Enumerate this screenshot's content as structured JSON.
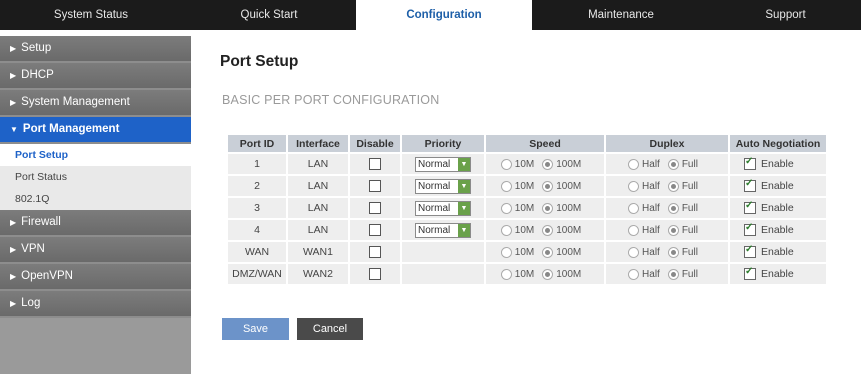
{
  "topnav": {
    "tabs": [
      {
        "label": "System Status"
      },
      {
        "label": "Quick Start"
      },
      {
        "label": "Configuration"
      },
      {
        "label": "Maintenance"
      },
      {
        "label": "Support"
      }
    ],
    "active": "Configuration"
  },
  "sidebar": {
    "items": [
      {
        "label": "Setup"
      },
      {
        "label": "DHCP"
      },
      {
        "label": "System Management"
      },
      {
        "label": "Port Management"
      },
      {
        "label": "Firewall"
      },
      {
        "label": "VPN"
      },
      {
        "label": "OpenVPN"
      },
      {
        "label": "Log"
      }
    ],
    "subitems": [
      {
        "label": "Port Setup"
      },
      {
        "label": "Port Status"
      },
      {
        "label": "802.1Q"
      }
    ]
  },
  "page": {
    "title": "Port Setup",
    "section": "BASIC PER PORT CONFIGURATION"
  },
  "table": {
    "headers": [
      "Port ID",
      "Interface",
      "Disable",
      "Priority",
      "Speed",
      "Duplex",
      "Auto Negotiation"
    ],
    "rows": [
      {
        "port": "1",
        "iface": "LAN",
        "priority": "Normal",
        "speed_a": "10M",
        "speed_b": "100M",
        "dup_a": "Half",
        "dup_b": "Full",
        "auto": "Enable"
      },
      {
        "port": "2",
        "iface": "LAN",
        "priority": "Normal",
        "speed_a": "10M",
        "speed_b": "100M",
        "dup_a": "Half",
        "dup_b": "Full",
        "auto": "Enable"
      },
      {
        "port": "3",
        "iface": "LAN",
        "priority": "Normal",
        "speed_a": "10M",
        "speed_b": "100M",
        "dup_a": "Half",
        "dup_b": "Full",
        "auto": "Enable"
      },
      {
        "port": "4",
        "iface": "LAN",
        "priority": "Normal",
        "speed_a": "10M",
        "speed_b": "100M",
        "dup_a": "Half",
        "dup_b": "Full",
        "auto": "Enable"
      },
      {
        "port": "WAN",
        "iface": "WAN1",
        "priority": "",
        "speed_a": "10M",
        "speed_b": "100M",
        "dup_a": "Half",
        "dup_b": "Full",
        "auto": "Enable"
      },
      {
        "port": "DMZ/WAN",
        "iface": "WAN2",
        "priority": "",
        "speed_a": "10M",
        "speed_b": "100M",
        "dup_a": "Half",
        "dup_b": "Full",
        "auto": "Enable"
      }
    ]
  },
  "buttons": {
    "save": "Save",
    "cancel": "Cancel"
  },
  "colors": {
    "topnav_bg": "#1b1b1b",
    "active_tab_text": "#1d5fa8",
    "sidebar_active": "#1e62c8",
    "save_button": "#6c93c9",
    "cancel_button": "#4a4a4a",
    "table_header": "#c9cfd7"
  }
}
